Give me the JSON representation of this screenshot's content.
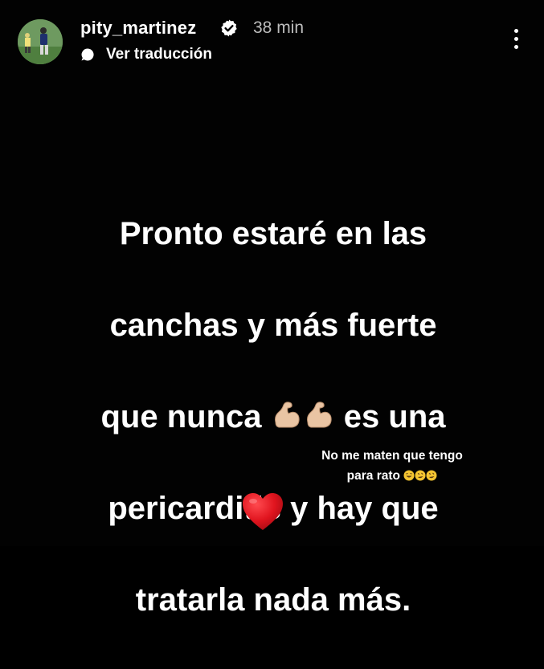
{
  "header": {
    "username": "pity_martinez",
    "time": "38 min",
    "translate_label": "Ver traducción"
  },
  "story": {
    "main_lines": [
      "Pronto estaré en las",
      "canchas y más fuerte",
      "que nunca",
      "es una",
      "pericarditis y hay que",
      "tratarla nada más."
    ],
    "small_lines": [
      "No me maten que tengo",
      "para rato"
    ],
    "emojis": [
      "flexed-biceps",
      "flexed-biceps",
      "laughing",
      "rolling-laughing",
      "rolling-laughing",
      "red-heart"
    ]
  },
  "colors": {
    "background": "#020202",
    "text": "#ffffff",
    "muted": "#bdbdbd",
    "verified_badge": "#ffffff",
    "heart": "#e0141e",
    "skin_tone": "#e9c4a3"
  }
}
